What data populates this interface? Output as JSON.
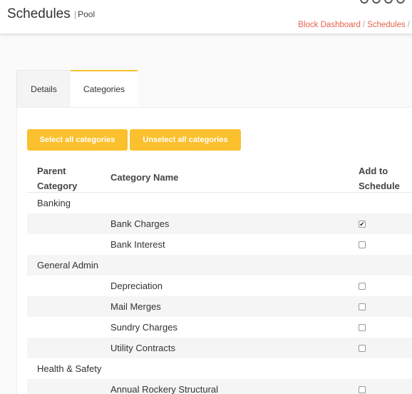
{
  "header": {
    "title": "Schedules",
    "subtitle_sep": "|",
    "subtitle": "Pool"
  },
  "breadcrumb": {
    "items": [
      "Block Dashboard",
      "Schedules"
    ],
    "separator": "/"
  },
  "tabs": [
    {
      "label": "Details",
      "active": false
    },
    {
      "label": "Categories",
      "active": true
    }
  ],
  "actions": {
    "select_all": "Select all categories",
    "unselect_all": "Unselect all categories"
  },
  "table": {
    "headers": {
      "parent_line1": "Parent",
      "parent_line2": "Category",
      "name": "Category Name",
      "add_line1": "Add to",
      "add_line2": "Schedule"
    },
    "rows": [
      {
        "parent": "Banking",
        "name": "",
        "checked": null
      },
      {
        "parent": "",
        "name": "Bank Charges",
        "checked": true
      },
      {
        "parent": "",
        "name": "Bank Interest",
        "checked": false
      },
      {
        "parent": "General Admin",
        "name": "",
        "checked": null
      },
      {
        "parent": "",
        "name": "Depreciation",
        "checked": false
      },
      {
        "parent": "",
        "name": "Mail Merges",
        "checked": false
      },
      {
        "parent": "",
        "name": "Sundry Charges",
        "checked": false
      },
      {
        "parent": "",
        "name": "Utility Contracts",
        "checked": false
      },
      {
        "parent": "Health & Safety",
        "name": "",
        "checked": null
      },
      {
        "parent": "",
        "name": "Annual Rockery Structural",
        "checked": false
      }
    ]
  },
  "colors": {
    "accent": "#fbc02d",
    "link": "#e3634b"
  },
  "icons": {
    "checkbox_checked": "✔"
  }
}
